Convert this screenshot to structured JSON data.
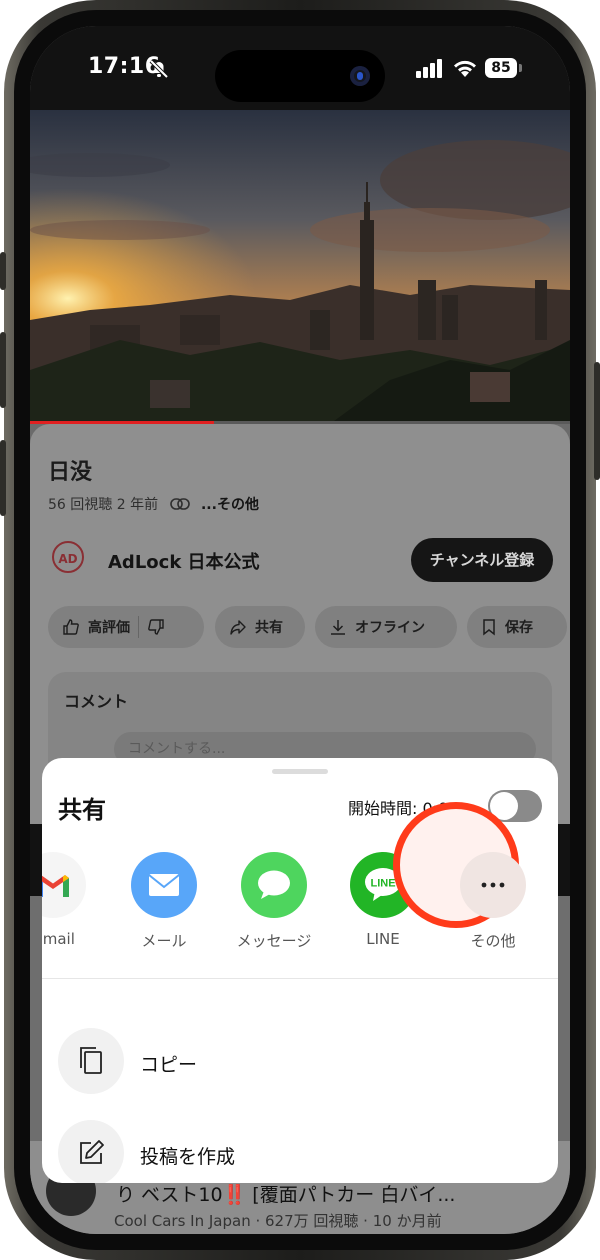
{
  "status_bar": {
    "time": "17:16",
    "battery": "85",
    "icons": [
      "bell-slash-icon",
      "signal-icon",
      "wifi-icon",
      "battery-icon"
    ]
  },
  "video": {
    "progress": 0.34
  },
  "info": {
    "title": "日没",
    "meta": "56 回視聴  2 年前",
    "more": "...その他",
    "channel_name": "AdLock 日本公式",
    "channel_logo": "AD",
    "subscribe": "チャンネル登録",
    "actions": [
      "高評価",
      "共有",
      "オフライン",
      "保存"
    ],
    "comments_title": "コメント",
    "comment_placeholder": "コメントする..."
  },
  "share_sheet": {
    "title": "共有",
    "start_time_label": "開始時間: 0:02",
    "start_time_enabled": false,
    "apps": [
      {
        "label": "Gmail",
        "icon": "gmail-icon",
        "color": "#f5f5f5"
      },
      {
        "label": "メール",
        "icon": "mail-icon",
        "color": "#58a6f9"
      },
      {
        "label": "メッセージ",
        "icon": "messages-icon",
        "color": "#4ed55e"
      },
      {
        "label": "LINE",
        "icon": "line-icon",
        "color": "#22b526"
      },
      {
        "label": "その他",
        "icon": "more-icon",
        "color": "#f0e5e2"
      }
    ],
    "actions": [
      {
        "label": "コピー",
        "icon": "copy-icon"
      },
      {
        "label": "投稿を作成",
        "icon": "compose-icon"
      }
    ]
  },
  "feed": {
    "title": "り ベスト10‼️ [覆面パトカー 白バイ...",
    "meta": "Cool Cars In Japan · 627万 回視聴 · 10 か月前"
  },
  "colors": {
    "highlight": "#ff3b1a",
    "progress": "#e02020"
  }
}
